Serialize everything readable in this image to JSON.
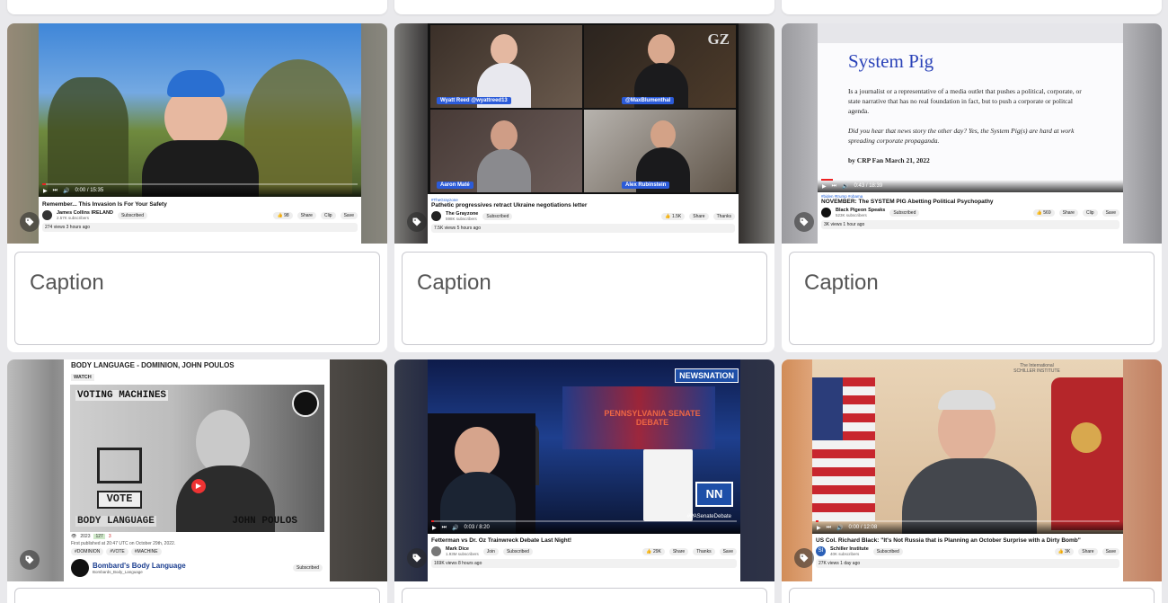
{
  "cards": [
    {
      "title": "Remember... This Invasion Is For Your Safety",
      "time": "0:00 / 15:35",
      "channel": "James Collins IRELAND",
      "subs": "2.57K subscribers",
      "subscribed": "Subscribed",
      "likes": "98",
      "actions": [
        "Share",
        "Clip",
        "Save"
      ],
      "views": "274 views  3 hours ago",
      "caption_placeholder": "Caption"
    },
    {
      "tag": "#TheGrayzone",
      "title": "Pathetic progressives retract Ukraine negotiations letter",
      "channel": "The Grayzone",
      "subs": "598K subscribers",
      "subscribed": "Subscribed",
      "likes": "1.5K",
      "actions": [
        "Share",
        "Thanks"
      ],
      "views": "7.5K views  5 hours ago",
      "logo": "GZ",
      "participants": [
        "Wyatt Reed @wyattreed13",
        "@MaxBlumenthal",
        "Aaron Maté",
        "Alex Rubinstein"
      ],
      "caption_placeholder": "Caption"
    },
    {
      "tag": "#biden #trump #obama",
      "title": "NOVEMBER: The SYSTEM PIG Abetting Political Psychopathy",
      "time": "0:43 / 18:39",
      "channel": "Black Pigeon Speaks",
      "subs": "523K subscribers",
      "subscribed": "Subscribed",
      "likes": "569",
      "actions": [
        "Share",
        "Clip",
        "Save"
      ],
      "views": "3K views  1 hour ago",
      "headline": "System Pig",
      "definition": "Is a journalist or a representative of a media outlet that pushes a political, corporate, or state narrative that has no real foundation in fact, but to push a corporate or politcal agenda.",
      "example": "Did you hear that news story the other day? Yes, the System Pig(s) are hard at work spreading corporate propaganda.",
      "byline": "by CRP Fan March 21, 2022",
      "caption_placeholder": "Caption"
    },
    {
      "header": "BODY LANGUAGE - DOMINION, JOHN POULOS",
      "watch": "WATCH",
      "overlay_top": "VOTING MACHINES",
      "box_label": "VOTE",
      "bottom_left": "BODY LANGUAGE",
      "bottom_right": "JOHN POULOS",
      "views_count": "2023",
      "up": "127",
      "down": "3",
      "published": "First published at 20:47 UTC on October 29th, 2022.",
      "hashtags": [
        "#DOMINION",
        "#VOTE",
        "#MACHINE"
      ],
      "channel": "Bombard's Body Language",
      "handle": "Bombards_Body_Language",
      "subscribed": "Subscribed"
    },
    {
      "network": "NEWSNATION",
      "studio": "PENNSYLVANIA SENATE DEBATE",
      "logo": "NN",
      "hashtag": "#PASenateDebate",
      "time": "0:03 / 8:20",
      "title": "Fetterman vs Dr. Oz Trainwreck Debate Last Night!",
      "channel": "Mark Dice",
      "subs": "1.93M subscribers",
      "join": "Join",
      "subscribed": "Subscribed",
      "likes": "29K",
      "actions": [
        "Share",
        "Thanks",
        "Save"
      ],
      "views": "169K views  8 hours ago"
    },
    {
      "institute": "The International SCHILLER INSTITUTE",
      "time": "0:00 / 12:08",
      "title": "US Col. Richard Black: \"It's Not Russia that is Planning an October Surprise with a Dirty Bomb\"",
      "channel": "Schiller Institute",
      "avatar_text": "SI",
      "subs": "40K subscribers",
      "subscribed": "Subscribed",
      "likes": "3K",
      "actions": [
        "Share",
        "Save"
      ],
      "views": "27K views  1 day ago"
    }
  ]
}
